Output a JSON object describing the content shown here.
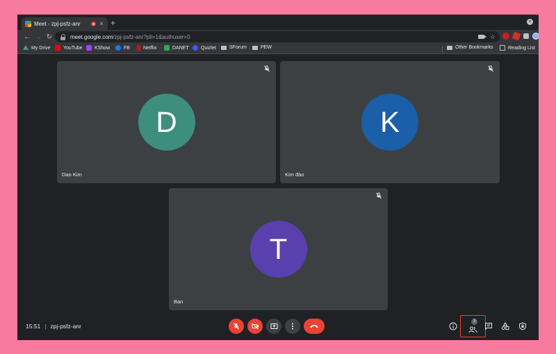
{
  "browser": {
    "tab_title": "Meet - zpj-psfz-anr",
    "tab_close": "×",
    "new_tab": "+",
    "window_close": "×",
    "url_host": "meet.google.com",
    "url_path": "/zpj-psfz-anr?pli=1&authuser=0",
    "nav": {
      "back": "←",
      "forward": "→",
      "reload": "↻"
    },
    "star": "☆",
    "menu": "⋮"
  },
  "bookmarks": [
    {
      "label": "My Drive",
      "icon": "drive-icon"
    },
    {
      "label": "YouTube",
      "icon": "youtube-icon"
    },
    {
      "label": "KShow",
      "icon": "kshow-icon"
    },
    {
      "label": "FB",
      "icon": "facebook-icon"
    },
    {
      "label": "Netflix",
      "icon": "netflix-icon"
    },
    {
      "label": "DANET",
      "icon": "danet-icon"
    },
    {
      "label": "Quizlet",
      "icon": "quizlet-icon"
    },
    {
      "label": "SForum",
      "icon": "folder-icon"
    },
    {
      "label": "PEW",
      "icon": "folder-icon"
    }
  ],
  "bookmarks_right": [
    {
      "label": "Other Bookmarks",
      "icon": "folder-icon"
    },
    {
      "label": "Reading List",
      "icon": "reading-list-icon"
    }
  ],
  "participants": [
    {
      "initial": "D",
      "name": "Dao Kim",
      "color": "#3e8e7e",
      "muted": true
    },
    {
      "initial": "K",
      "name": "Kim đào",
      "color": "#1a5fa8",
      "muted": true
    },
    {
      "initial": "T",
      "name": "Bạn",
      "color": "#5a3fae",
      "muted": true
    }
  ],
  "meeting": {
    "time": "15:51",
    "separator": "|",
    "code": "zpj-psfz-anr",
    "people_count": "3"
  },
  "controls": {
    "mic": {
      "state": "off",
      "icon": "mic-off-icon"
    },
    "camera": {
      "state": "off",
      "icon": "camera-off-icon"
    },
    "present": {
      "icon": "present-icon"
    },
    "more": {
      "icon": "more-vert-icon"
    },
    "end_call": {
      "icon": "end-call-icon"
    }
  },
  "colors": {
    "danger": "#ea4335",
    "tile_bg": "#3c4043",
    "highlight_border": "#e8462e",
    "frame": "#f97a9f"
  }
}
